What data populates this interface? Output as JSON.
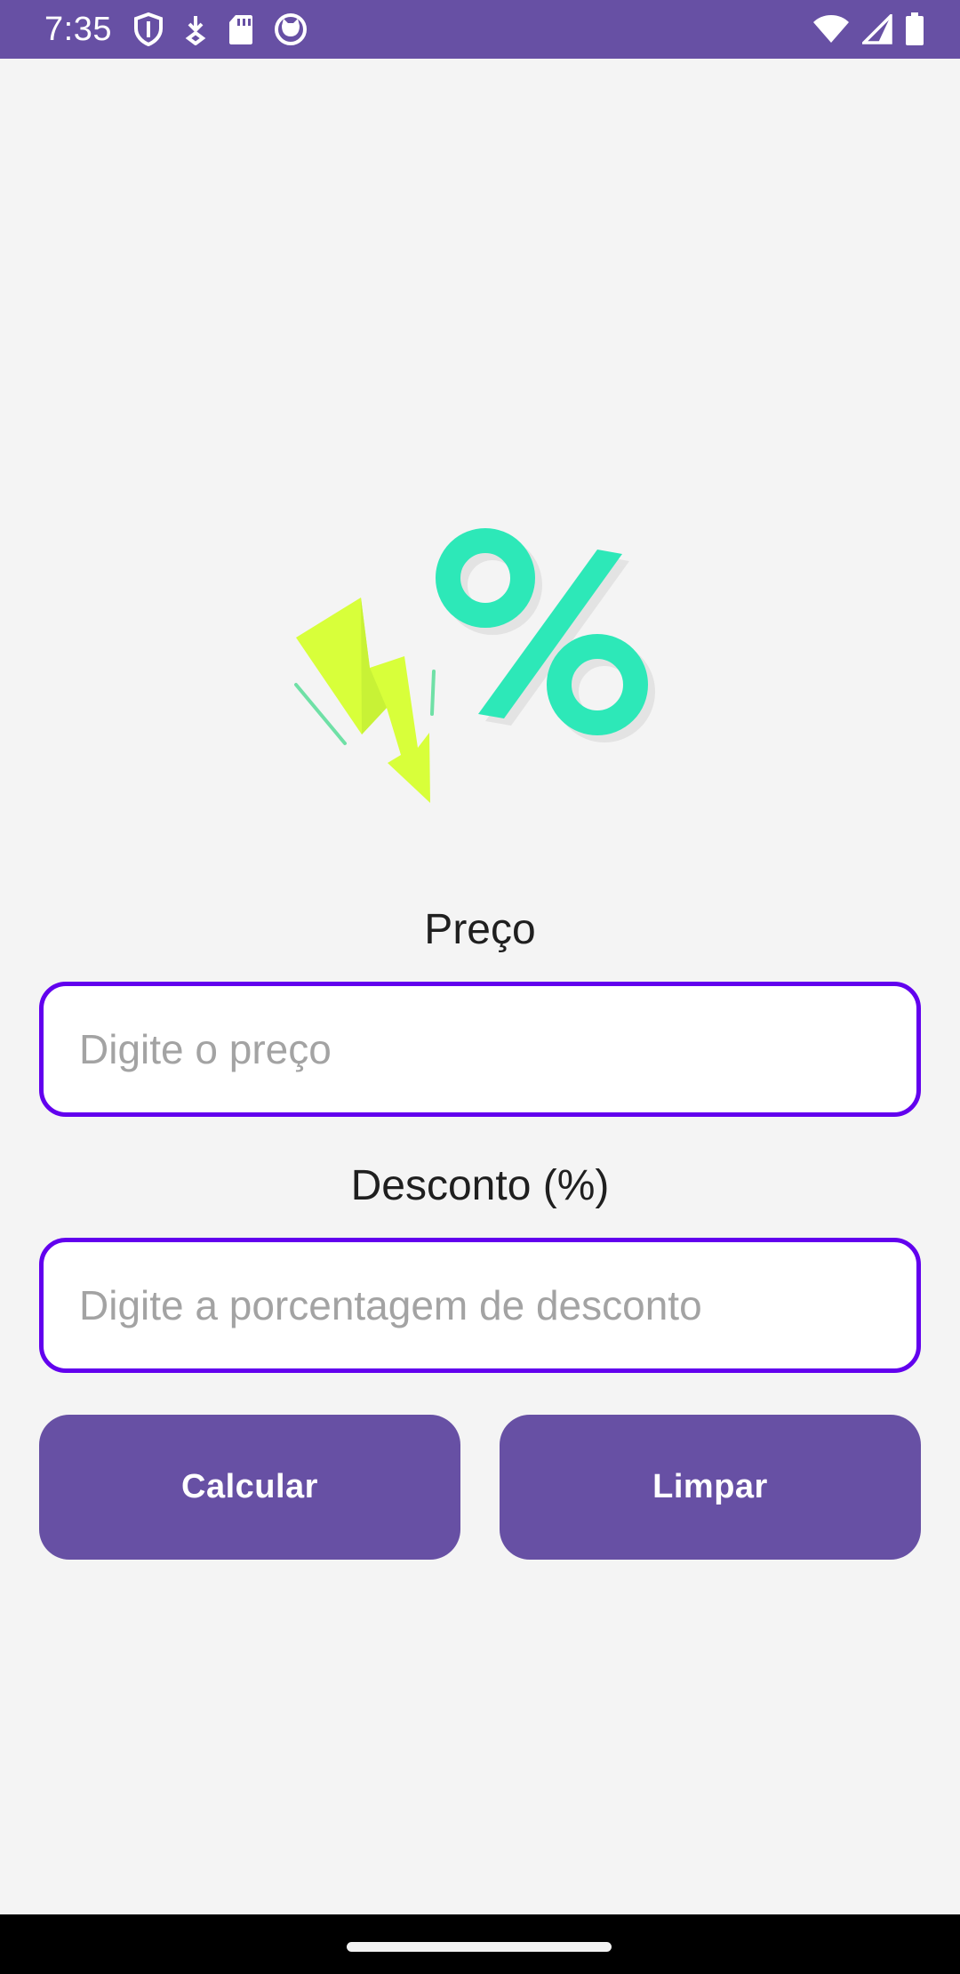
{
  "status_bar": {
    "time": "7:35",
    "left_icons": [
      "shield-icon",
      "download-icon",
      "sd-card-icon",
      "cat-face-icon"
    ],
    "right_icons": [
      "wifi-icon",
      "signal-icon",
      "battery-icon"
    ],
    "color": "#6750a4"
  },
  "hero": {
    "icon": "discount-percent-illustration",
    "colors": {
      "percent": "#2de8b8",
      "bolt": "#d8ff3a"
    }
  },
  "form": {
    "price_label": "Preço",
    "price_placeholder": "Digite o preço",
    "price_value": "",
    "discount_label": "Desconto (%)",
    "discount_placeholder": "Digite a porcentagem de desconto",
    "discount_value": "",
    "border_color": "#6200ee"
  },
  "buttons": {
    "calculate_label": "Calcular",
    "clear_label": "Limpar",
    "color": "#6750a4"
  }
}
